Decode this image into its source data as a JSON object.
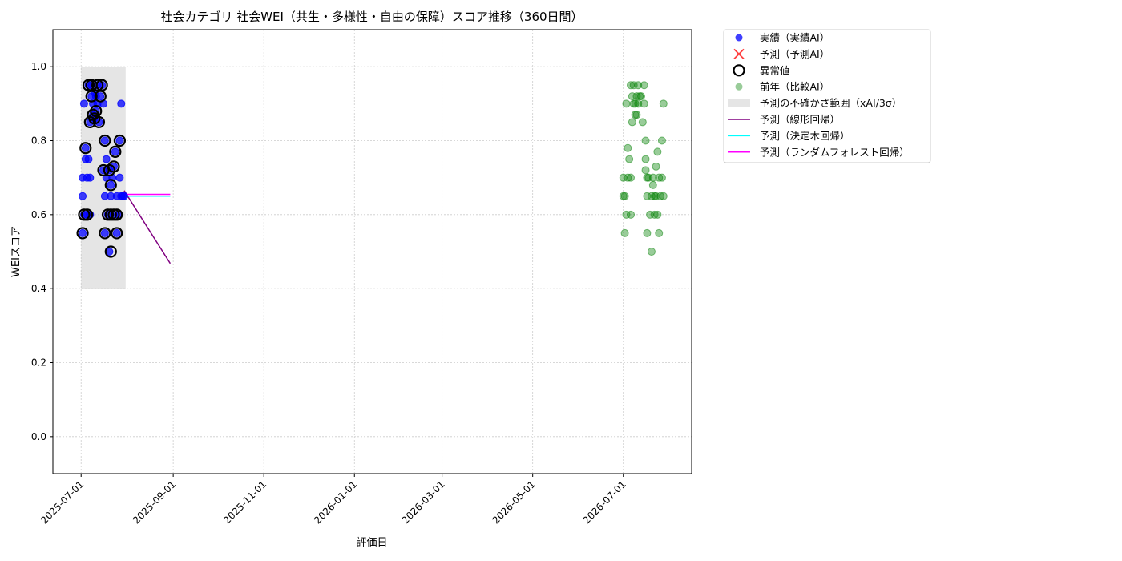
{
  "chart_data": {
    "type": "scatter",
    "title": "社会カテゴリ 社会WEI（共生・多様性・自由の保障）スコア推移（360日間）",
    "xlabel": "評価日",
    "ylabel": "WEIスコア",
    "xlim": [
      "2025-06-12",
      "2026-08-16"
    ],
    "ylim": [
      -0.1,
      1.1
    ],
    "x_ticks": [
      "2025-07-01",
      "2025-09-01",
      "2025-11-01",
      "2026-01-01",
      "2026-03-01",
      "2026-05-01",
      "2026-07-01"
    ],
    "y_ticks": [
      "0.0",
      "0.2",
      "0.4",
      "0.6",
      "0.8",
      "1.0"
    ],
    "grid": true,
    "legend_position": "outside-top-right",
    "legend": [
      {
        "label": "実績（実績AI）",
        "kind": "dot",
        "color": "#0000ff"
      },
      {
        "label": "予測（予測AI）",
        "kind": "x",
        "color": "#ff0000"
      },
      {
        "label": "異常値",
        "kind": "ring",
        "color": "#000000"
      },
      {
        "label": "前年（比較AI）",
        "kind": "dot-faint",
        "color": "#008000"
      },
      {
        "label": "予測の不確かさ範囲（xAI/3σ）",
        "kind": "band",
        "color": "#cccccc"
      },
      {
        "label": "予測（線形回帰）",
        "kind": "line",
        "color": "#800080"
      },
      {
        "label": "予測（決定木回帰）",
        "kind": "line",
        "color": "#00ffff"
      },
      {
        "label": "予測（ランダムフォレスト回帰）",
        "kind": "line",
        "color": "#ff00ff"
      }
    ],
    "uncertainty_band": {
      "x": [
        "2025-07-01",
        "2025-07-31"
      ],
      "y": [
        0.4,
        1.0
      ],
      "color": "#cccccc"
    },
    "series": [
      {
        "name": "実績（実績AI）",
        "color": "#0000ff",
        "points": [
          [
            "2025-07-02",
            0.55
          ],
          [
            "2025-07-02",
            0.65
          ],
          [
            "2025-07-02",
            0.7
          ],
          [
            "2025-07-03",
            0.6
          ],
          [
            "2025-07-03",
            0.9
          ],
          [
            "2025-07-04",
            0.75
          ],
          [
            "2025-07-04",
            0.78
          ],
          [
            "2025-07-05",
            0.7
          ],
          [
            "2025-07-05",
            0.6
          ],
          [
            "2025-07-06",
            0.95
          ],
          [
            "2025-07-06",
            0.75
          ],
          [
            "2025-07-07",
            0.6
          ],
          [
            "2025-07-07",
            0.7
          ],
          [
            "2025-07-07",
            0.85
          ],
          [
            "2025-07-08",
            0.92
          ],
          [
            "2025-07-08",
            0.95
          ],
          [
            "2025-07-09",
            0.9
          ],
          [
            "2025-07-09",
            0.87
          ],
          [
            "2025-07-10",
            0.93
          ],
          [
            "2025-07-10",
            0.86
          ],
          [
            "2025-07-11",
            0.88
          ],
          [
            "2025-07-11",
            0.92
          ],
          [
            "2025-07-12",
            0.95
          ],
          [
            "2025-07-12",
            0.9
          ],
          [
            "2025-07-13",
            0.85
          ],
          [
            "2025-07-14",
            0.92
          ],
          [
            "2025-07-15",
            0.95
          ],
          [
            "2025-07-16",
            0.9
          ],
          [
            "2025-07-16",
            0.72
          ],
          [
            "2025-07-17",
            0.8
          ],
          [
            "2025-07-17",
            0.55
          ],
          [
            "2025-07-17",
            0.65
          ],
          [
            "2025-07-18",
            0.7
          ],
          [
            "2025-07-18",
            0.75
          ],
          [
            "2025-07-19",
            0.6
          ],
          [
            "2025-07-20",
            0.72
          ],
          [
            "2025-07-20",
            0.5
          ],
          [
            "2025-07-21",
            0.68
          ],
          [
            "2025-07-21",
            0.65
          ],
          [
            "2025-07-22",
            0.7
          ],
          [
            "2025-07-23",
            0.6
          ],
          [
            "2025-07-23",
            0.73
          ],
          [
            "2025-07-24",
            0.77
          ],
          [
            "2025-07-25",
            0.55
          ],
          [
            "2025-07-25",
            0.65
          ],
          [
            "2025-07-26",
            0.6
          ],
          [
            "2025-07-27",
            0.8
          ],
          [
            "2025-07-27",
            0.7
          ],
          [
            "2025-07-28",
            0.65
          ],
          [
            "2025-07-29",
            0.65
          ],
          [
            "2025-07-30",
            0.65
          ],
          [
            "2025-07-28",
            0.9
          ]
        ]
      },
      {
        "name": "異常値",
        "color": "#000000",
        "points": [
          [
            "2025-07-02",
            0.55
          ],
          [
            "2025-07-03",
            0.6
          ],
          [
            "2025-07-04",
            0.78
          ],
          [
            "2025-07-05",
            0.6
          ],
          [
            "2025-07-06",
            0.95
          ],
          [
            "2025-07-07",
            0.85
          ],
          [
            "2025-07-08",
            0.92
          ],
          [
            "2025-07-08",
            0.95
          ],
          [
            "2025-07-09",
            0.87
          ],
          [
            "2025-07-10",
            0.86
          ],
          [
            "2025-07-11",
            0.88
          ],
          [
            "2025-07-12",
            0.95
          ],
          [
            "2025-07-13",
            0.85
          ],
          [
            "2025-07-14",
            0.92
          ],
          [
            "2025-07-15",
            0.95
          ],
          [
            "2025-07-16",
            0.72
          ],
          [
            "2025-07-17",
            0.8
          ],
          [
            "2025-07-17",
            0.55
          ],
          [
            "2025-07-19",
            0.6
          ],
          [
            "2025-07-20",
            0.72
          ],
          [
            "2025-07-21",
            0.68
          ],
          [
            "2025-07-21",
            0.5
          ],
          [
            "2025-07-23",
            0.6
          ],
          [
            "2025-07-23",
            0.73
          ],
          [
            "2025-07-24",
            0.77
          ],
          [
            "2025-07-25",
            0.55
          ],
          [
            "2025-07-25",
            0.6
          ],
          [
            "2025-07-27",
            0.8
          ],
          [
            "2025-07-21",
            0.6
          ]
        ]
      },
      {
        "name": "前年（比較AI）",
        "color": "#008000",
        "points": [
          [
            "2026-07-01",
            0.7
          ],
          [
            "2026-07-01",
            0.65
          ],
          [
            "2026-07-02",
            0.65
          ],
          [
            "2026-07-02",
            0.55
          ],
          [
            "2026-07-03",
            0.9
          ],
          [
            "2026-07-03",
            0.6
          ],
          [
            "2026-07-04",
            0.78
          ],
          [
            "2026-07-04",
            0.7
          ],
          [
            "2026-07-05",
            0.75
          ],
          [
            "2026-07-06",
            0.6
          ],
          [
            "2026-07-06",
            0.7
          ],
          [
            "2026-07-06",
            0.95
          ],
          [
            "2026-07-07",
            0.92
          ],
          [
            "2026-07-07",
            0.85
          ],
          [
            "2026-07-08",
            0.9
          ],
          [
            "2026-07-08",
            0.95
          ],
          [
            "2026-07-09",
            0.9
          ],
          [
            "2026-07-09",
            0.87
          ],
          [
            "2026-07-10",
            0.92
          ],
          [
            "2026-07-10",
            0.87
          ],
          [
            "2026-07-11",
            0.9
          ],
          [
            "2026-07-11",
            0.95
          ],
          [
            "2026-07-12",
            0.92
          ],
          [
            "2026-07-13",
            0.92
          ],
          [
            "2026-07-14",
            0.85
          ],
          [
            "2026-07-15",
            0.95
          ],
          [
            "2026-07-15",
            0.9
          ],
          [
            "2026-07-16",
            0.75
          ],
          [
            "2026-07-16",
            0.8
          ],
          [
            "2026-07-16",
            0.72
          ],
          [
            "2026-07-17",
            0.55
          ],
          [
            "2026-07-17",
            0.65
          ],
          [
            "2026-07-17",
            0.7
          ],
          [
            "2026-07-18",
            0.7
          ],
          [
            "2026-07-19",
            0.6
          ],
          [
            "2026-07-20",
            0.5
          ],
          [
            "2026-07-20",
            0.65
          ],
          [
            "2026-07-21",
            0.68
          ],
          [
            "2026-07-21",
            0.7
          ],
          [
            "2026-07-22",
            0.6
          ],
          [
            "2026-07-23",
            0.73
          ],
          [
            "2026-07-23",
            0.65
          ],
          [
            "2026-07-24",
            0.77
          ],
          [
            "2026-07-25",
            0.55
          ],
          [
            "2026-07-25",
            0.7
          ],
          [
            "2026-07-26",
            0.65
          ],
          [
            "2026-07-27",
            0.8
          ],
          [
            "2026-07-27",
            0.7
          ],
          [
            "2026-07-28",
            0.9
          ],
          [
            "2026-07-28",
            0.65
          ],
          [
            "2026-07-22",
            0.65
          ],
          [
            "2026-07-24",
            0.6
          ]
        ]
      }
    ],
    "forecast_lines": [
      {
        "name": "予測（線形回帰）",
        "color": "#800080",
        "x": [
          "2025-07-30",
          "2025-08-30"
        ],
        "y": [
          0.665,
          0.468
        ]
      },
      {
        "name": "予測（決定木回帰）",
        "color": "#00ffff",
        "x": [
          "2025-07-30",
          "2025-08-30"
        ],
        "y": [
          0.65,
          0.65
        ]
      },
      {
        "name": "予測（ランダムフォレスト回帰）",
        "color": "#ff00ff",
        "x": [
          "2025-07-30",
          "2025-08-30"
        ],
        "y": [
          0.655,
          0.655
        ]
      }
    ]
  }
}
